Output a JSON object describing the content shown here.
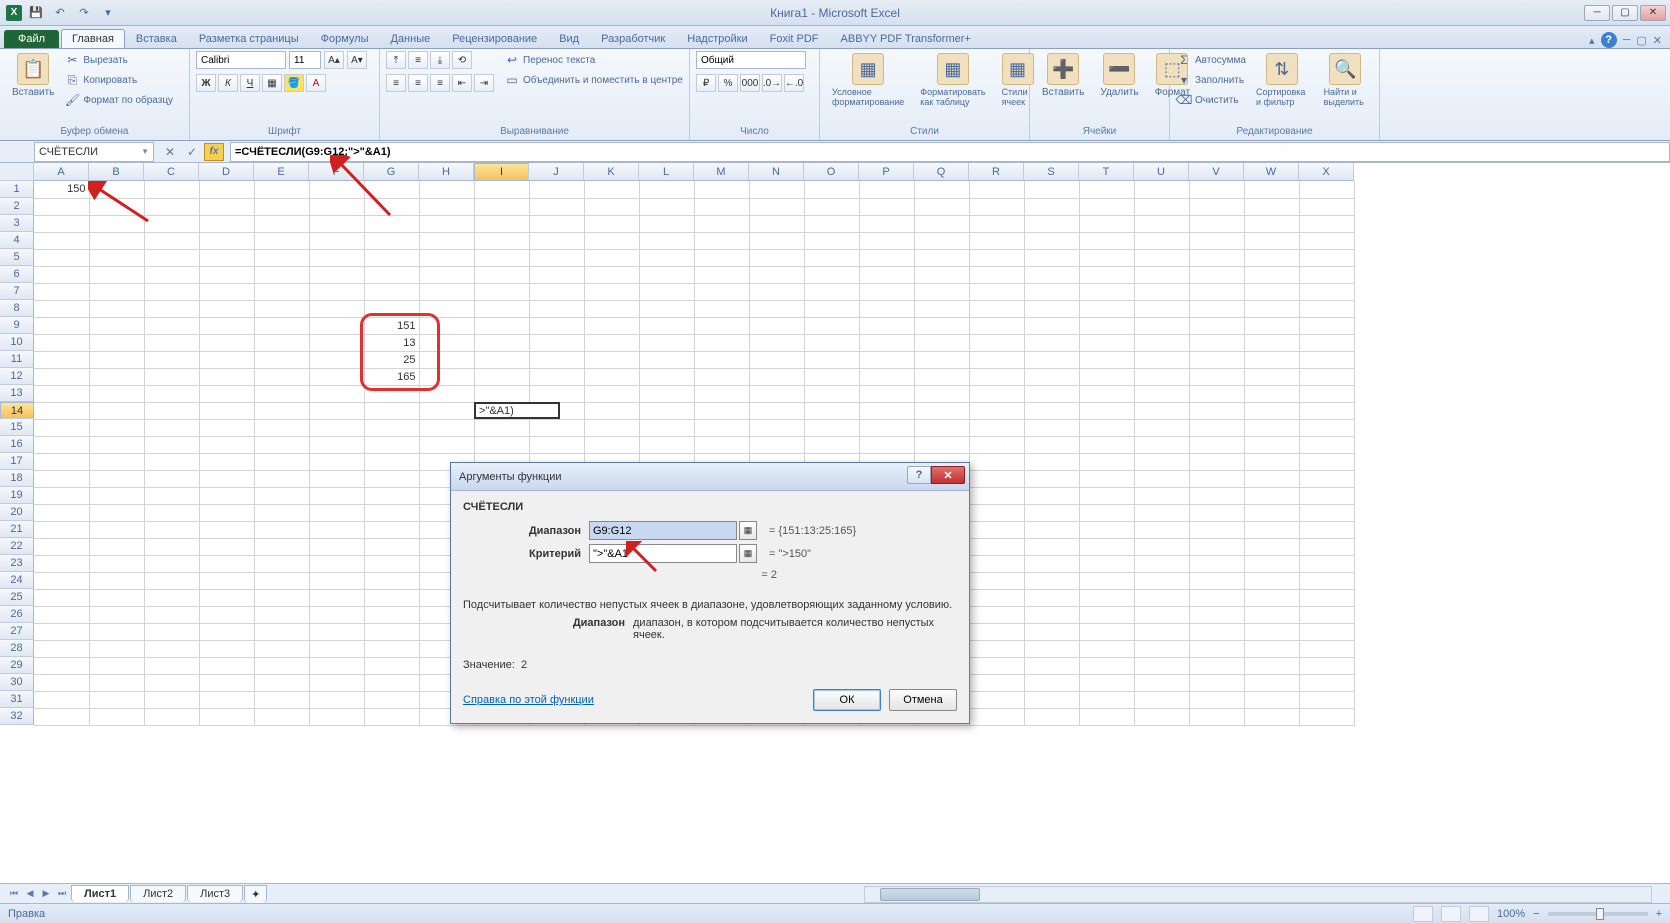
{
  "title": "Книга1 - Microsoft Excel",
  "qat": {
    "save": "💾",
    "undo": "↶",
    "redo": "↷"
  },
  "tabs": {
    "file": "Файл",
    "items": [
      "Главная",
      "Вставка",
      "Разметка страницы",
      "Формулы",
      "Данные",
      "Рецензирование",
      "Вид",
      "Разработчик",
      "Надстройки",
      "Foxit PDF",
      "ABBYY PDF Transformer+"
    ],
    "active": 0
  },
  "ribbon": {
    "clipboard": {
      "label": "Буфер обмена",
      "paste": "Вставить",
      "cut": "Вырезать",
      "copy": "Копировать",
      "format": "Формат по образцу"
    },
    "font": {
      "label": "Шрифт",
      "name": "Calibri",
      "size": "11"
    },
    "align": {
      "label": "Выравнивание",
      "wrap": "Перенос текста",
      "merge": "Объединить и поместить в центре"
    },
    "number": {
      "label": "Число",
      "format": "Общий"
    },
    "styles": {
      "label": "Стили",
      "cond": "Условное форматирование",
      "table": "Форматировать как таблицу",
      "cell": "Стили ячеек"
    },
    "cells": {
      "label": "Ячейки",
      "insert": "Вставить",
      "delete": "Удалить",
      "format": "Формат"
    },
    "editing": {
      "label": "Редактирование",
      "sum": "Автосумма",
      "fill": "Заполнить",
      "clear": "Очистить",
      "sort": "Сортировка и фильтр",
      "find": "Найти и выделить"
    }
  },
  "namebox": "СЧЁТЕСЛИ",
  "formula": "=СЧЁТЕСЛИ(G9:G12;\">\"&A1)",
  "columns": [
    "A",
    "B",
    "C",
    "D",
    "E",
    "F",
    "G",
    "H",
    "I",
    "J",
    "K",
    "L",
    "M",
    "N",
    "O",
    "P",
    "Q",
    "R",
    "S",
    "T",
    "U",
    "V",
    "W",
    "X"
  ],
  "rows": 32,
  "active_col": "I",
  "active_row": 14,
  "cell_values": {
    "A1": "150",
    "G9": "151",
    "G10": "13",
    "G11": "25",
    "G12": "165"
  },
  "active_cell_display": ">\"&A1)",
  "dialog": {
    "title": "Аргументы функции",
    "func": "СЧЁТЕСЛИ",
    "arg1_label": "Диапазон",
    "arg1_value": "G9:G12",
    "arg1_result": "= {151:13:25:165}",
    "arg2_label": "Критерий",
    "arg2_value": "\">\"&A1",
    "arg2_result": "= \">150\"",
    "preview": "= 2",
    "desc": "Подсчитывает количество непустых ячеек в диапазоне, удовлетворяющих заданному условию.",
    "arg_desc_label": "Диапазон",
    "arg_desc": "диапазон, в котором подсчитывается количество непустых ячеек.",
    "result_label": "Значение:",
    "result_value": "2",
    "help": "Справка по этой функции",
    "ok": "ОК",
    "cancel": "Отмена"
  },
  "sheets": {
    "items": [
      "Лист1",
      "Лист2",
      "Лист3"
    ],
    "active": 0
  },
  "status": {
    "mode": "Правка",
    "zoom": "100%"
  }
}
